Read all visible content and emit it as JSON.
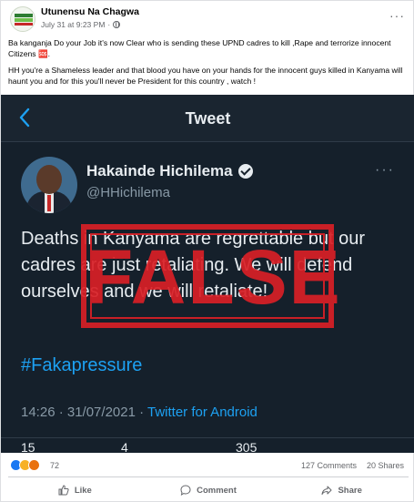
{
  "post": {
    "page_name": "Utunensu Na Chagwa",
    "timestamp": "July 31 at 9:23 PM",
    "separator": "·",
    "more_label": "···",
    "text_p1": "Ba kanganja Do your Job it's now Clear who is sending these UPND cadres to kill ,Rape and terrorize innocent Citizens 🆘.",
    "text_p2": "HH you're a Shameless leader and that blood you have on your hands for the innocent guys killed in Kanyama will haunt you and for this you'll never be President for this country , watch !"
  },
  "tweet": {
    "header_title": "Tweet",
    "name": "Hakainde Hichilema",
    "handle": "@HHichilema",
    "more_label": "···",
    "body": "Deaths in Kanyama are regrettable but our cadres are just retaliating. We will defend ourselves and we will retaliate!",
    "hashtag": "#Fakapressure",
    "time": "14:26 · 31/07/2021 · ",
    "client": "Twitter for Android",
    "bottom_retweets": "15",
    "bottom_quotes": "4",
    "bottom_likes": "305"
  },
  "stamp": {
    "label": "FALSE",
    "color": "#d91f26"
  },
  "engagement": {
    "reaction_count": "72",
    "comments": "127 Comments",
    "shares": "20 Shares"
  },
  "actions": {
    "like": "Like",
    "comment": "Comment",
    "share": "Share"
  },
  "colors": {
    "tweet_bg": "#15202b",
    "twitter_blue": "#1da1f2",
    "facebook_blue": "#1877f2"
  }
}
